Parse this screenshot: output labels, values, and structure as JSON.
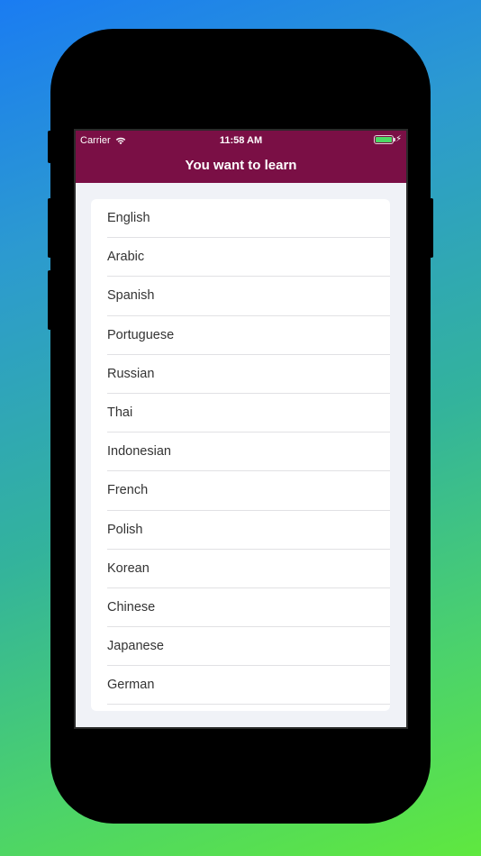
{
  "status_bar": {
    "carrier": "Carrier",
    "time": "11:58 AM",
    "wifi_icon": "wifi-icon",
    "battery_icon": "battery-icon",
    "charging_icon": "bolt-icon"
  },
  "nav": {
    "title": "You want to learn"
  },
  "languages": [
    "English",
    "Arabic",
    "Spanish",
    "Portuguese",
    "Russian",
    "Thai",
    "Indonesian",
    "French",
    "Polish",
    "Korean",
    "Chinese",
    "Japanese",
    "German"
  ],
  "colors": {
    "nav_background": "#7a0f45",
    "screen_background": "#f0f2f7",
    "battery_fill": "#4cd964"
  }
}
